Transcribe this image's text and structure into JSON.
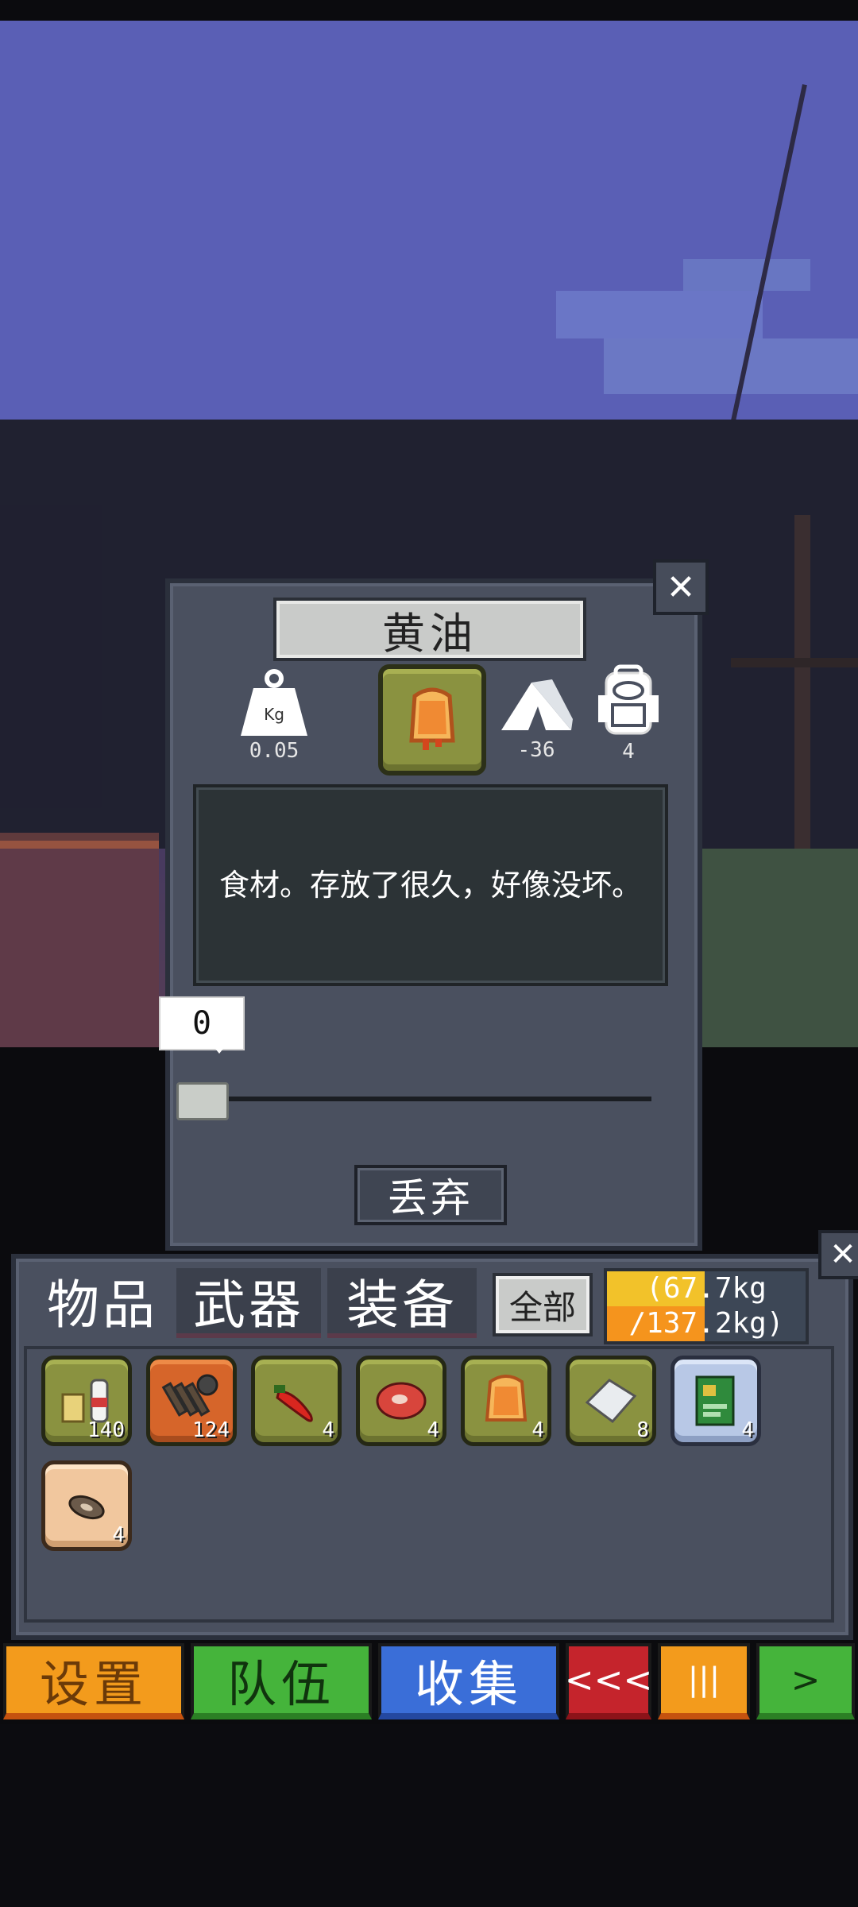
{
  "item_popup": {
    "title": "黄油",
    "weight_value": "0.05",
    "weight_icon_label": "Kg",
    "temperature_value": "-36",
    "capacity_value": "4",
    "description": "食材。存放了很久，好像没坏。",
    "quantity": "0",
    "quantity_fraction": 0,
    "discard_label": "丢弃",
    "close_label": "✕"
  },
  "inventory": {
    "tabs": [
      {
        "label": "物品"
      },
      {
        "label": "武器"
      },
      {
        "label": "装备"
      }
    ],
    "filter_label": "全部",
    "weight": {
      "current": "(67.7kg",
      "max": "/137.2kg)",
      "fraction": 0.49
    },
    "close_label": "✕",
    "items": [
      {
        "icon": "supplies-icon",
        "count": "140",
        "rarity": "olive"
      },
      {
        "icon": "ammo-belt-icon",
        "count": "124",
        "rarity": "orange"
      },
      {
        "icon": "chili-pepper-icon",
        "count": "4",
        "rarity": "olive"
      },
      {
        "icon": "raw-meat-icon",
        "count": "4",
        "rarity": "olive"
      },
      {
        "icon": "butter-icon",
        "count": "4",
        "rarity": "olive"
      },
      {
        "icon": "salt-bag-icon",
        "count": "8",
        "rarity": "olive"
      },
      {
        "icon": "circuit-board-icon",
        "count": "4",
        "rarity": "light"
      },
      {
        "icon": "tape-roll-icon",
        "count": "4",
        "rarity": "peach"
      }
    ]
  },
  "bottom_menu": {
    "settings": "设置",
    "team": "队伍",
    "collect": "收集",
    "back": "<<<",
    "pause": "|||",
    "forward": ">"
  },
  "colors": {
    "panel": "#4a505f",
    "sky": "#5a5fb5",
    "accent_orange": "#f39b1c",
    "accent_green": "#45b43b",
    "accent_blue": "#3a6ed8",
    "accent_red": "#c5242c"
  }
}
